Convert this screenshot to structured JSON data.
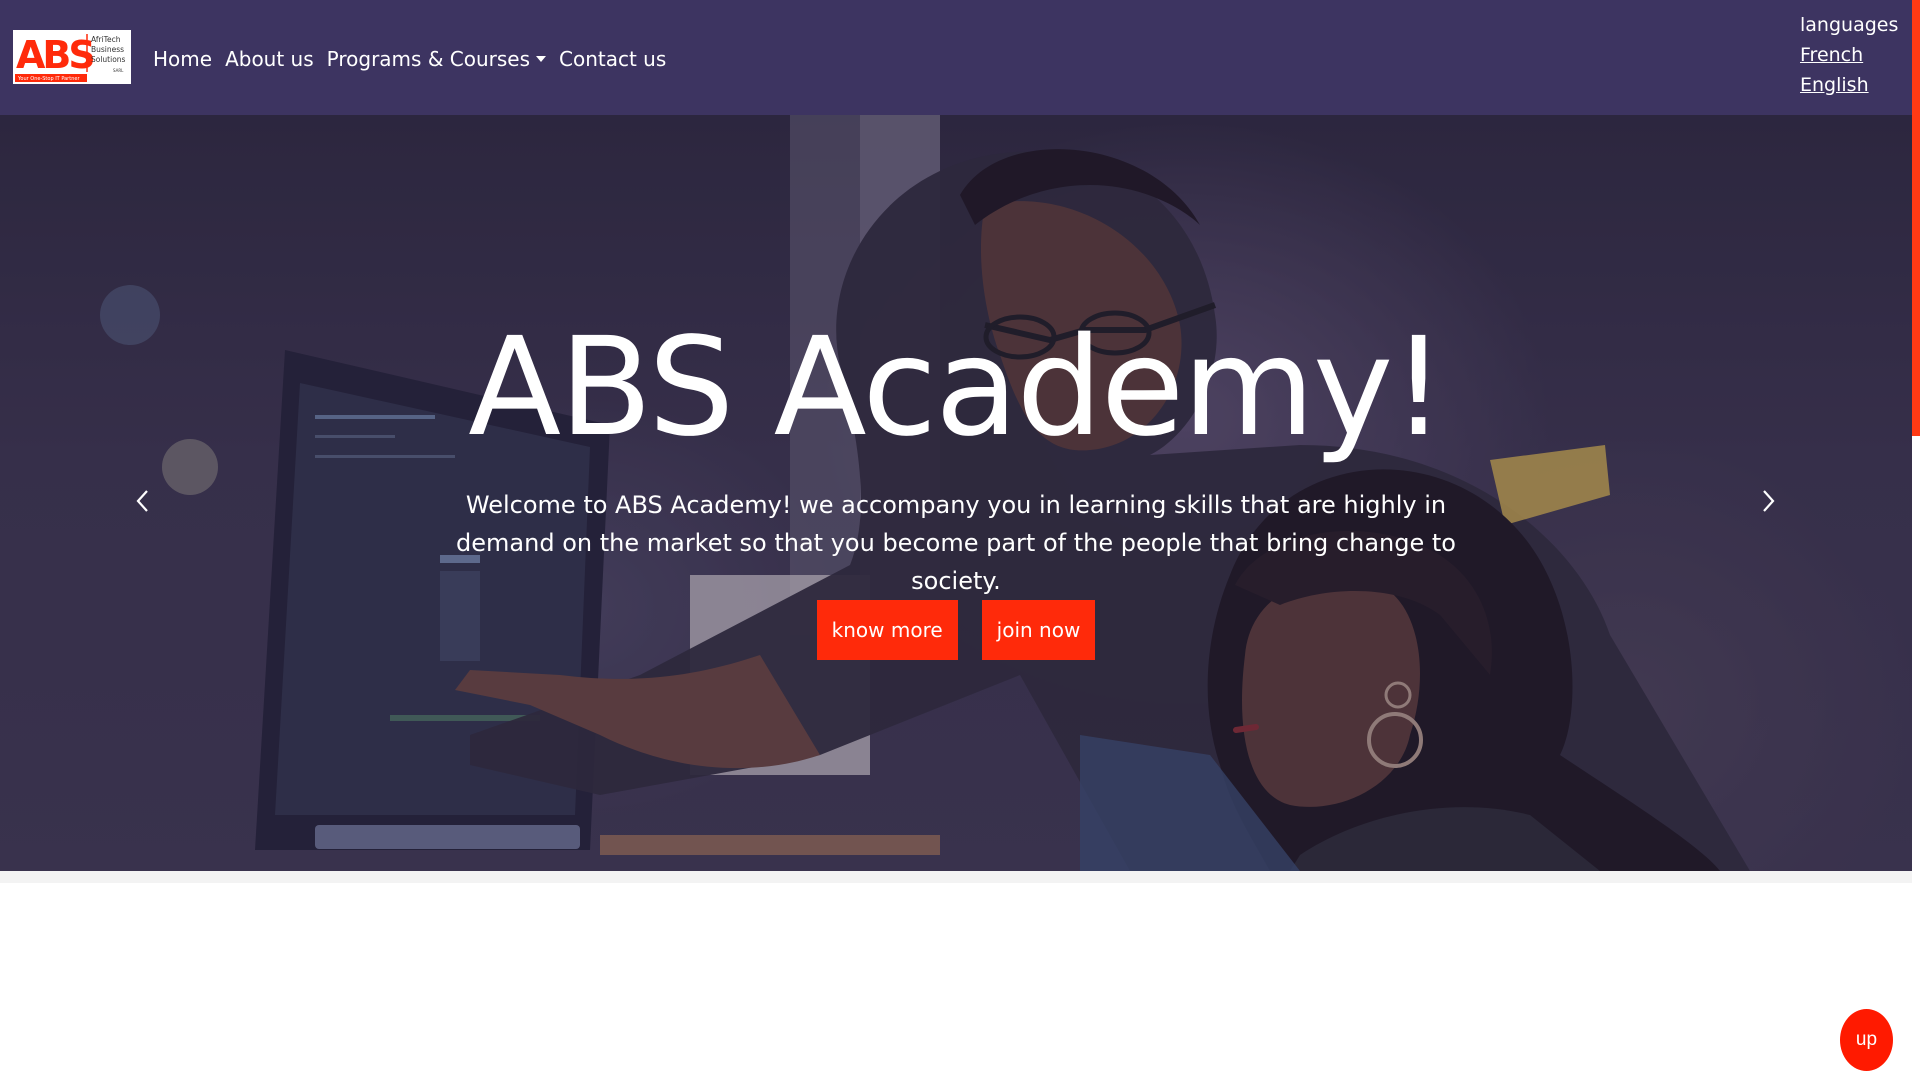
{
  "brand": {
    "logo_mark": "ABS",
    "logo_lines": [
      "AfriTech",
      "Business",
      "Solutions"
    ],
    "logo_suffix": "SARL",
    "logo_tagline": "Your One-Stop IT Partner"
  },
  "nav": {
    "items": [
      {
        "label": "Home"
      },
      {
        "label": "About us"
      },
      {
        "label": "Programs & Courses",
        "has_dropdown": true
      },
      {
        "label": "Contact us"
      }
    ]
  },
  "languages": {
    "heading": "languages",
    "options": [
      "French",
      "English"
    ]
  },
  "hero": {
    "title": "ABS Academy!",
    "subtitle": "Welcome to ABS Academy! we accompany you in learning skills that are highly in demand on the market so that you become part of the people that bring change to society.",
    "primary_button": "know more",
    "secondary_button": "join now",
    "prev_icon": "chevron-left-icon",
    "next_icon": "chevron-right-icon"
  },
  "up_button": {
    "label": "up"
  },
  "colors": {
    "navbar": "#3d3461",
    "accent": "#ff2a0a",
    "text_on_dark": "#ffffff"
  }
}
